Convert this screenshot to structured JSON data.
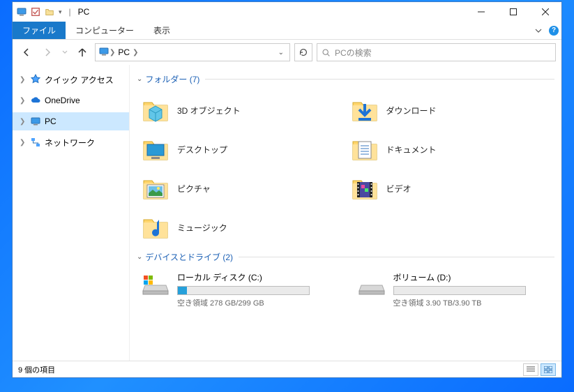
{
  "title": "PC",
  "ribbon": {
    "file": "ファイル",
    "tabs": [
      "コンピューター",
      "表示"
    ]
  },
  "nav": {
    "crumb": "PC",
    "search_placeholder": "PCの検索"
  },
  "tree": [
    {
      "label": "クイック アクセス",
      "icon": "star",
      "expandable": true,
      "selected": false
    },
    {
      "label": "OneDrive",
      "icon": "cloud",
      "expandable": true,
      "selected": false
    },
    {
      "label": "PC",
      "icon": "monitor",
      "expandable": true,
      "selected": true
    },
    {
      "label": "ネットワーク",
      "icon": "network",
      "expandable": true,
      "selected": false
    }
  ],
  "groups": {
    "folders": {
      "header": "フォルダー (7)",
      "items": [
        {
          "label": "3D オブジェクト",
          "overlay": "cube"
        },
        {
          "label": "ダウンロード",
          "overlay": "download"
        },
        {
          "label": "デスクトップ",
          "overlay": "desktop"
        },
        {
          "label": "ドキュメント",
          "overlay": "document"
        },
        {
          "label": "ピクチャ",
          "overlay": "picture"
        },
        {
          "label": "ビデオ",
          "overlay": "video"
        },
        {
          "label": "ミュージック",
          "overlay": "music"
        }
      ]
    },
    "drives": {
      "header": "デバイスとドライブ (2)",
      "items": [
        {
          "name": "ローカル ディスク (C:)",
          "free_text": "空き領域 278 GB/299 GB",
          "fill_pct": 7,
          "os": true
        },
        {
          "name": "ボリューム (D:)",
          "free_text": "空き領域 3.90 TB/3.90 TB",
          "fill_pct": 0,
          "os": false
        }
      ]
    }
  },
  "status": {
    "count": "9 個の項目"
  }
}
